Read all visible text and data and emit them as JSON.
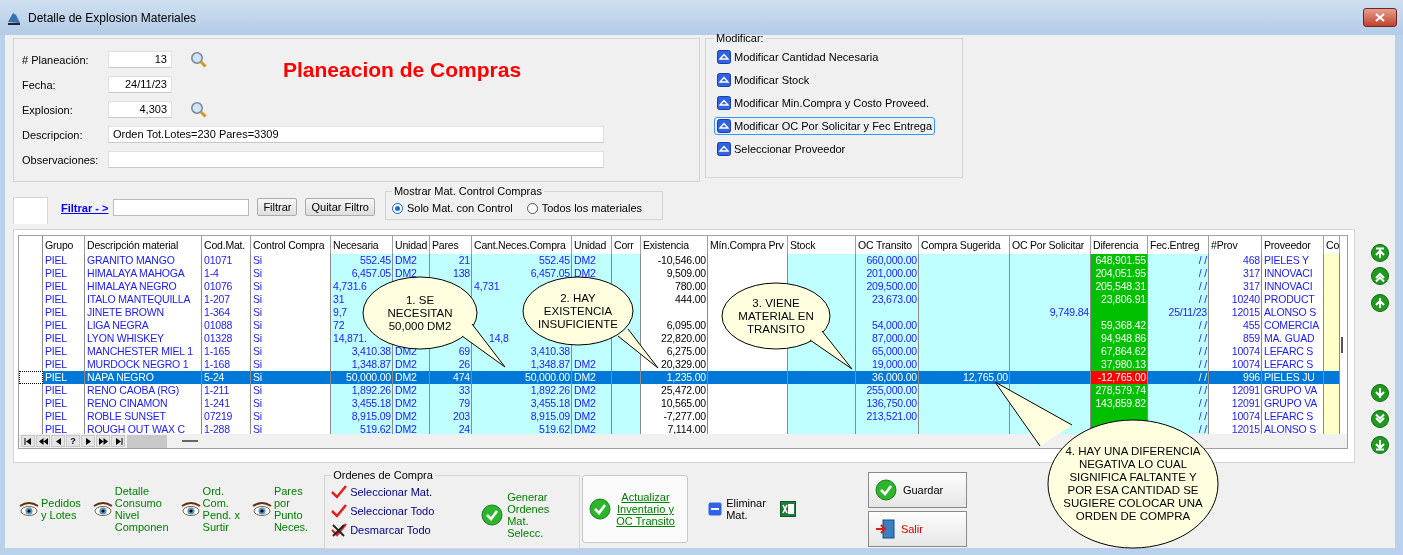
{
  "window": {
    "title": "Detalle de Explosion Materiales"
  },
  "form": {
    "title": "Planeacion de Compras",
    "fields": [
      {
        "label": "# Planeación:",
        "value": "13",
        "search": true
      },
      {
        "label": "Fecha:",
        "value": "24/11/23",
        "search": false
      },
      {
        "label": "Explosion:",
        "value": "4,303",
        "search": true
      },
      {
        "label": "Descripcion:",
        "value": "Orden  Tot.Lotes=230 Pares=3309",
        "search": false
      },
      {
        "label": "Observaciones:",
        "search": false
      }
    ]
  },
  "modify": {
    "legend": "Modificar:",
    "options": [
      {
        "label": "Modificar Cantidad Necesaria",
        "focused": false
      },
      {
        "label": "Modificar Stock",
        "focused": false
      },
      {
        "label": "Modificar Min.Compra y Costo Proveed.",
        "focused": false
      },
      {
        "label": "Modificar OC Por Solicitar y Fec Entrega",
        "focused": true
      },
      {
        "label": "Seleccionar Proveedor",
        "focused": false
      }
    ]
  },
  "filter": {
    "link": "Filtrar - >",
    "buttons": [
      "Filtrar",
      "Quitar Filtro"
    ]
  },
  "show_group": {
    "legend": "Mostrar Mat. Control Compras",
    "options": [
      {
        "label": "Solo Mat. con Control",
        "selected": true
      },
      {
        "label": "Todos los materiales",
        "selected": false
      }
    ]
  },
  "table": {
    "columns": [
      "Grupo",
      "Descripción material",
      "Cod.Mat.",
      "Control Compra",
      "Necesaria",
      "Unidad",
      "Pares",
      "Cant.Neces.Compra",
      "Unidad",
      "Corr",
      "Existencia",
      "Mín.Compra Prv",
      "Stock",
      "OC Transito",
      "Compra Sugerida",
      "OC Por Solicitar",
      "Diferencia",
      "Fec.Entreg",
      "#Prov",
      "Proveedor",
      "Co"
    ],
    "rows": [
      {
        "selected": false,
        "alert": false,
        "cells": [
          "PIEL",
          "GRANITO MANGO",
          "01071",
          "Si",
          "552.45",
          "DM2",
          "21",
          "552.45",
          "DM2",
          null,
          "-10,546.00",
          null,
          null,
          "660,000.00",
          null,
          null,
          "648,901.55",
          "/ /",
          "468",
          "PIELES Y",
          null
        ]
      },
      {
        "selected": false,
        "alert": false,
        "cells": [
          "PIEL",
          "HIMALAYA MAHOGA",
          "1-4",
          "Si",
          "6,457.05",
          "DM2",
          "138",
          "6,457.05",
          "DM2",
          null,
          "9,509.00",
          null,
          null,
          "201,000.00",
          null,
          null,
          "204,051.95",
          "/ /",
          "317",
          "INNOVACI",
          null
        ]
      },
      {
        "selected": false,
        "alert": false,
        "cells": [
          "PIEL",
          "HIMALAYA NEGRO",
          "01076",
          "Si",
          "4,731.6",
          null,
          null,
          "4,731",
          null,
          null,
          "780.00",
          null,
          null,
          "209,500.00",
          null,
          null,
          "205,548.31",
          "/ /",
          "317",
          "INNOVACI",
          null
        ]
      },
      {
        "selected": false,
        "alert": false,
        "cells": [
          "PIEL",
          "ITALO MANTEQUILLA",
          "1-207",
          "Si",
          "31",
          null,
          null,
          null,
          null,
          null,
          "444.00",
          null,
          null,
          "23,673.00",
          null,
          null,
          "23,806.91",
          "/ /",
          "10240",
          "PRODUCT",
          null
        ]
      },
      {
        "selected": false,
        "alert": false,
        "cells": [
          "PIEL",
          "JINETE BROWN",
          "1-364",
          "Si",
          "9,7",
          null,
          null,
          null,
          null,
          null,
          null,
          null,
          null,
          null,
          null,
          "9,749.84",
          null,
          "25/11/23",
          "12015",
          "ALONSO S",
          null
        ]
      },
      {
        "selected": false,
        "alert": false,
        "cells": [
          "PIEL",
          "LIGA NEGRA",
          "01088",
          "Si",
          "72",
          null,
          null,
          null,
          null,
          null,
          "6,095.00",
          null,
          null,
          "54,000.00",
          null,
          null,
          "59,368.42",
          "/ /",
          "455",
          "COMERCIA",
          null
        ]
      },
      {
        "selected": false,
        "alert": false,
        "cells": [
          "PIEL",
          "LYON WHISKEY",
          "01328",
          "Si",
          "14,871.",
          null,
          null,
          "14,8",
          null,
          null,
          "22,820.00",
          null,
          null,
          "87,000.00",
          null,
          null,
          "94,948.86",
          "/ /",
          "859",
          "MA. GUAD",
          null
        ]
      },
      {
        "selected": false,
        "alert": false,
        "cells": [
          "PIEL",
          "MANCHESTER MIEL 1",
          "1-165",
          "Si",
          "3,410.38",
          "DM2",
          "69",
          "3,410.38",
          null,
          null,
          "6,275.00",
          null,
          null,
          "65,000.00",
          null,
          null,
          "67,864.62",
          "/ /",
          "10074",
          "LEFARC S",
          null
        ]
      },
      {
        "selected": false,
        "alert": false,
        "cells": [
          "PIEL",
          "MURDOCK NEGRO 1",
          "1-168",
          "Si",
          "1,348.87",
          "DM2",
          "26",
          "1,348.87",
          "DM2",
          null,
          "20,329.00",
          null,
          null,
          "19,000.00",
          null,
          null,
          "37,980.13",
          "/ /",
          "10074",
          "LEFARC S",
          null
        ]
      },
      {
        "selected": true,
        "alert": true,
        "cells": [
          "PIEL",
          "NAPA NEGRO",
          "5-24",
          "Si",
          "50,000.00",
          "DM2",
          "474",
          "50,000.00",
          "DM2",
          null,
          "1,235.00",
          null,
          null,
          "36,000.00",
          "12,765.00",
          null,
          "-12,765.00",
          "/ /",
          "996",
          "PIELES JU",
          null
        ]
      },
      {
        "selected": false,
        "alert": false,
        "cells": [
          "PIEL",
          "RENO CAOBA (RG)",
          "1-211",
          "Si",
          "1,892.26",
          "DM2",
          "33",
          "1,892.26",
          "DM2",
          null,
          "25,472.00",
          null,
          null,
          "255,000.00",
          null,
          null,
          "278,579.74",
          "/ /",
          "12091",
          "GRUPO VA",
          null
        ]
      },
      {
        "selected": false,
        "alert": false,
        "cells": [
          "PIEL",
          "RENO CINAMON",
          "1-241",
          "Si",
          "3,455.18",
          "DM2",
          "79",
          "3,455.18",
          "DM2",
          null,
          "10,565.00",
          null,
          null,
          "136,750.00",
          null,
          null,
          "143,859.82",
          "/ /",
          "12091",
          "GRUPO VA",
          null
        ]
      },
      {
        "selected": false,
        "alert": false,
        "cells": [
          "PIEL",
          "ROBLE SUNSET",
          "07219",
          "Si",
          "8,915.09",
          "DM2",
          "203",
          "8,915.09",
          "DM2",
          null,
          "-7,277.00",
          null,
          null,
          "213,521.00",
          null,
          null,
          null,
          "/ /",
          "10074",
          "LEFARC S",
          null
        ]
      },
      {
        "selected": false,
        "alert": false,
        "cells": [
          "PIEL",
          "ROUGH OUT WAX C",
          "1-288",
          "Si",
          "519.62",
          "DM2",
          "24",
          "519.62",
          "DM2",
          null,
          "7,114.00",
          null,
          null,
          null,
          null,
          null,
          null,
          "/ /",
          "12015",
          "ALONSO S",
          null
        ]
      }
    ],
    "nav_help": "?"
  },
  "callouts": [
    "1. SE\nNECESITAN\n50,000 DM2",
    "2. HAY\nEXISTENCIA\nINSUFICIENTE",
    "3. VIENE\nMATERIAL EN\nTRANSITO",
    "4. HAY UNA DIFERENCIA\nNEGATIVA LO CUAL\nSIGNIFICA FALTANTE Y\nPOR ESA CANTIDAD SE\nSUGIERE COLOCAR UNA\nORDEN DE COMPRA"
  ],
  "bottom": {
    "actions": [
      "Pedidos\ny Lotes",
      "Detalle\nConsumo\nNivel\nComponen",
      "Ord.\nCom.\nPend. x\nSurtir",
      "Pares\npor\nPunto\nNeces."
    ],
    "orders": {
      "legend": "Ordenes de Compra",
      "items": [
        {
          "label": "Seleccionar Mat.",
          "kind": "check"
        },
        {
          "label": "Seleccionar Todo",
          "kind": "check"
        },
        {
          "label": "Desmarcar Todo",
          "kind": "cross"
        }
      ],
      "generate": "Generar\nOrdenes\nMat.\nSelecc."
    },
    "update": "Actualizar\nInventario y\nOC Transito",
    "delete": "Eliminar\nMat.",
    "save": "Guardar",
    "exit": "Salir"
  }
}
